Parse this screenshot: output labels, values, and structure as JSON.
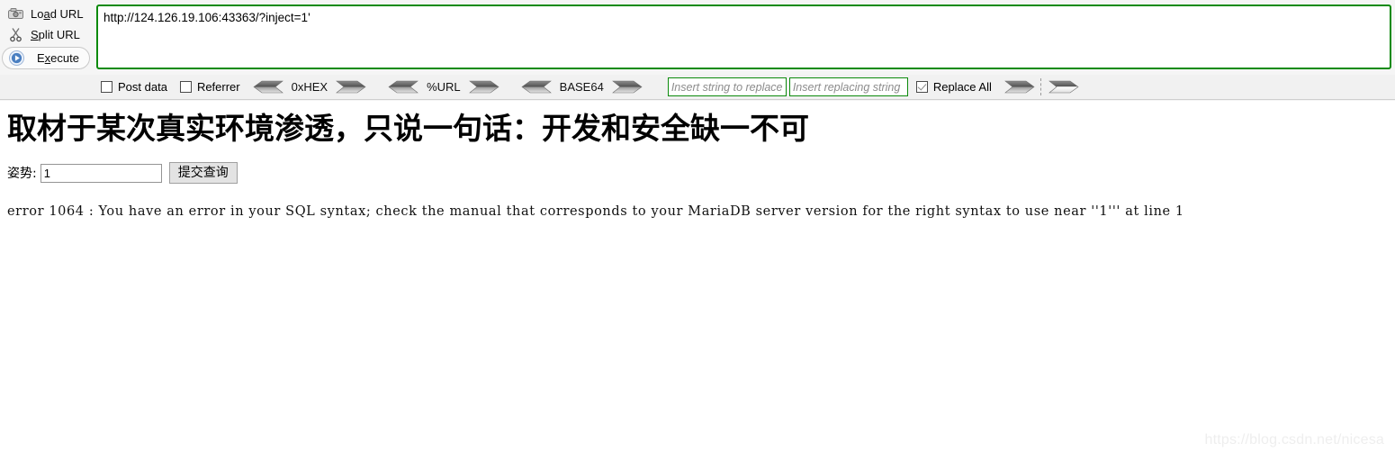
{
  "hackbar": {
    "actions": [
      {
        "icon": "load-url-icon",
        "label": "Load URL",
        "accel": "a"
      },
      {
        "icon": "split-url-icon",
        "label": "Split URL",
        "accel": "S"
      },
      {
        "icon": "execute-icon",
        "label": "Execute",
        "accel": "x"
      }
    ],
    "url_value": "http://124.126.19.106:43363/?inject=1'",
    "checkboxes": [
      {
        "label": "Post data",
        "checked": false
      },
      {
        "label": "Referrer",
        "checked": false
      }
    ],
    "codecs": [
      {
        "name": "0xHEX"
      },
      {
        "name": "%URL"
      },
      {
        "name": "BASE64"
      }
    ],
    "replace_search_placeholder": "Insert string to replace",
    "replace_search_value": "",
    "replace_with_placeholder": "Insert replacing string",
    "replace_with_value": "",
    "replace_all": {
      "label": "Replace All",
      "checked": true
    },
    "border_color": "#0c8a0c",
    "toolbar_bg": "#f1f1f1"
  },
  "page": {
    "heading": "取材于某次真实环境渗透，只说一句话：开发和安全缺一不可",
    "form": {
      "label": "姿势:",
      "input_value": "1",
      "input_placeholder": "",
      "submit_label": "提交查询"
    },
    "error_text": "error 1064 : You have an error in your SQL syntax; check the manual that corresponds to your MariaDB server version for the right syntax to use near ''1''' at line 1",
    "watermark": "https://blog.csdn.net/nicesa"
  }
}
